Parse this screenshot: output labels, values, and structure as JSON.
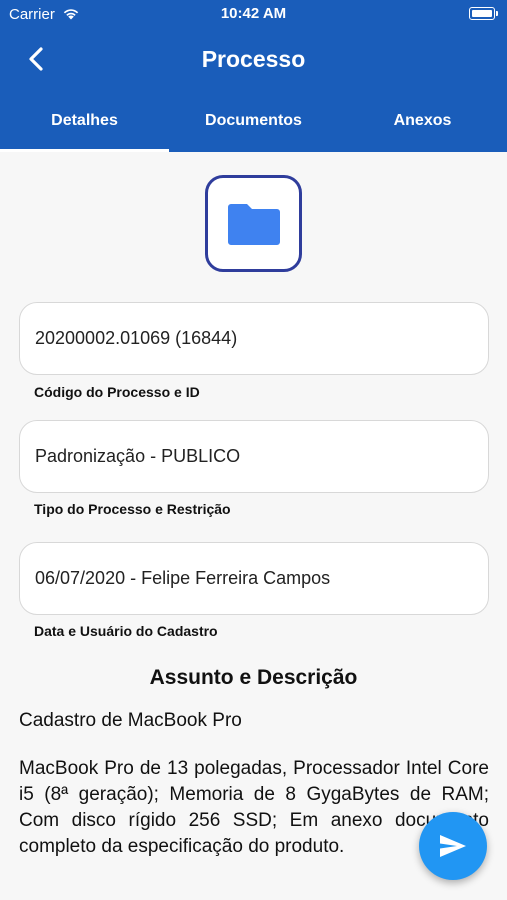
{
  "status": {
    "carrier": "Carrier",
    "time": "10:42 AM"
  },
  "header": {
    "title": "Processo"
  },
  "tabs": [
    {
      "label": "Detalhes",
      "active": true
    },
    {
      "label": "Documentos",
      "active": false
    },
    {
      "label": "Anexos",
      "active": false
    }
  ],
  "fields": [
    {
      "value": "20200002.01069 (16844)",
      "label": "Código do Processo e ID"
    },
    {
      "value": "Padronização - PUBLICO",
      "label": "Tipo do Processo e Restrição"
    },
    {
      "value": "06/07/2020 - Felipe Ferreira Campos",
      "label": "Data e Usuário do Cadastro"
    }
  ],
  "section": {
    "title": "Assunto e Descrição",
    "subject": "Cadastro de MacBook Pro",
    "description": "MacBook Pro de 13 polegadas, Processador Intel Core i5 (8ª geração); Memoria de 8 GygaBytes de RAM; Com disco rígido 256 SSD; Em anexo documento completo da especificação do produto."
  },
  "colors": {
    "header": "#1a5dba",
    "fab": "#2196f3",
    "folder": "#3f82f0",
    "folder_border": "#2f3d9c"
  },
  "icons": {
    "back": "chevron-left-icon",
    "folder": "folder-icon",
    "send": "send-icon",
    "wifi": "wifi-icon",
    "battery": "battery-icon"
  }
}
